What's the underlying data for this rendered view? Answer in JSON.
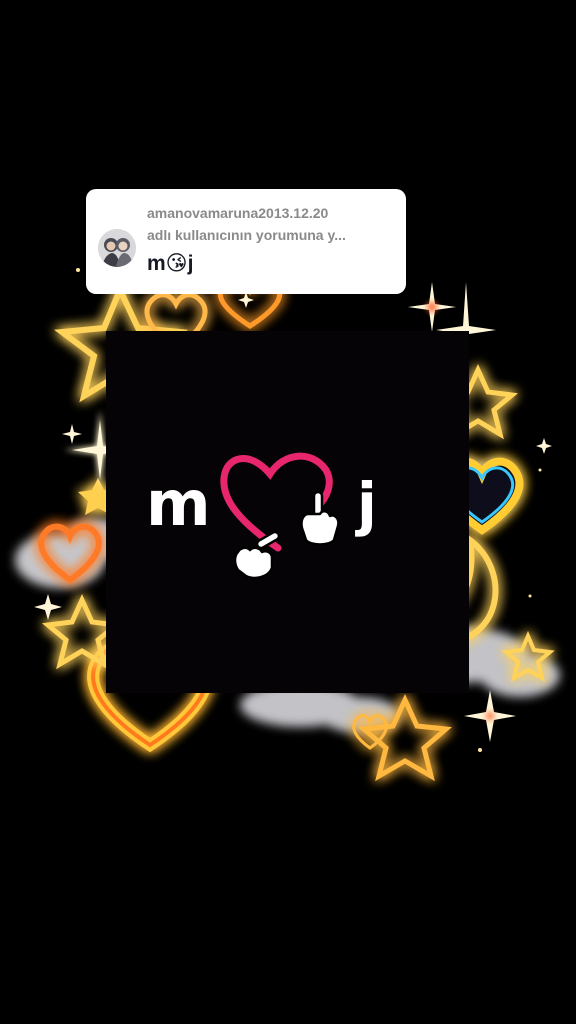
{
  "comment": {
    "username": "amanovamaruna2013.12.20",
    "subtitle": "adlı kullanıcının yorumuna y...",
    "text": "m😘j"
  },
  "artwork": {
    "letter_left": "m",
    "letter_right": "j"
  },
  "icons": [
    "profile-avatar-icon",
    "heart-icon",
    "pointing-hand-icon",
    "crescent-moon-icon",
    "star-icon",
    "sparkle-icon",
    "cloud-icon"
  ],
  "colors": {
    "background": "#000000",
    "heart_pink": "#e8266e",
    "glow_gold": "#ffc83a",
    "glow_orange": "#ff8a1e",
    "comment_bg": "#ffffff"
  }
}
